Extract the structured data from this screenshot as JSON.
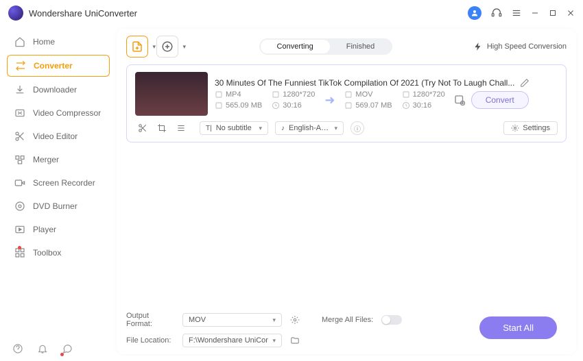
{
  "titlebar": {
    "product": "Wondershare UniConverter"
  },
  "sidebar": {
    "items": [
      {
        "label": "Home"
      },
      {
        "label": "Converter"
      },
      {
        "label": "Downloader"
      },
      {
        "label": "Video Compressor"
      },
      {
        "label": "Video Editor"
      },
      {
        "label": "Merger"
      },
      {
        "label": "Screen Recorder"
      },
      {
        "label": "DVD Burner"
      },
      {
        "label": "Player"
      },
      {
        "label": "Toolbox"
      }
    ]
  },
  "tabs": {
    "converting": "Converting",
    "finished": "Finished"
  },
  "toolbar": {
    "highspeed": "High Speed Conversion"
  },
  "file": {
    "title": "30 Minutes Of The Funniest TikTok Compilation Of 2021 (Try Not To Laugh Chall...",
    "src": {
      "format": "MP4",
      "resolution": "1280*720",
      "size": "565.09 MB",
      "duration": "30:16"
    },
    "dst": {
      "format": "MOV",
      "resolution": "1280*720",
      "size": "569.07 MB",
      "duration": "30:16"
    },
    "subtitle": "No subtitle",
    "audio": "English-Advan...",
    "settings": "Settings",
    "convert": "Convert"
  },
  "footer": {
    "output_label": "Output Format:",
    "output_value": "MOV",
    "location_label": "File Location:",
    "location_value": "F:\\Wondershare UniConverter",
    "merge_label": "Merge All Files:",
    "start": "Start All"
  }
}
